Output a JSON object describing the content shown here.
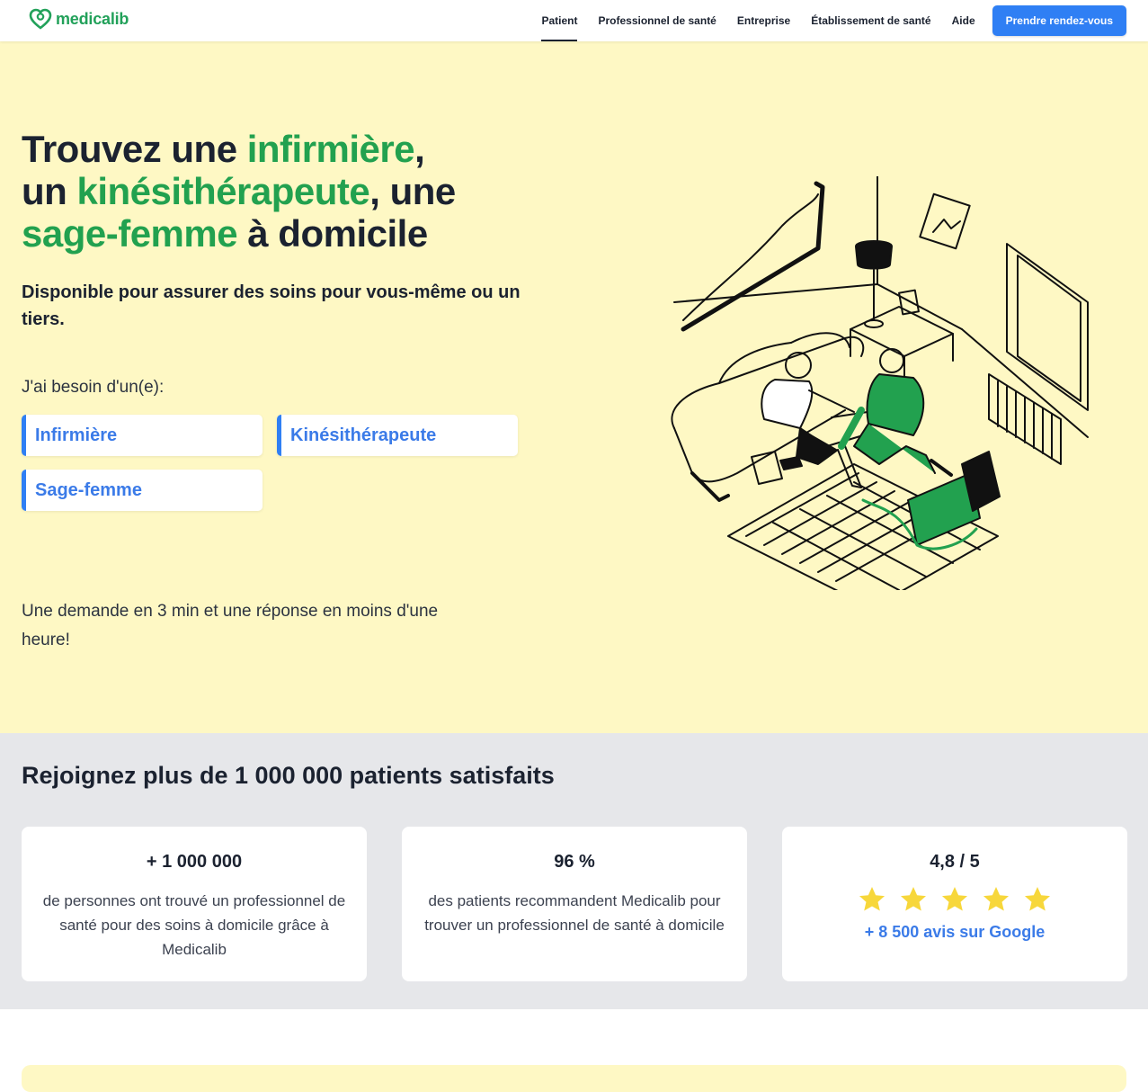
{
  "header": {
    "logo_text": "medicalib",
    "nav": [
      "Patient",
      "Professionnel de santé",
      "Entreprise",
      "Établissement de santé",
      "Aide"
    ],
    "cta_label": "Prendre rendez-vous"
  },
  "hero": {
    "title": {
      "p1": "Trouvez une ",
      "h1": "infirmière",
      "p2": ",",
      "p3": "un ",
      "h2": "kinésithérapeute",
      "p4": ", une",
      "h3": "sage-femme",
      "p5": " à domicile"
    },
    "subtitle": "Disponible pour assurer des soins pour vous-même ou un tiers.",
    "need_label": "J'ai besoin d'un(e):",
    "choices": [
      "Infirmière",
      "Kinésithérapeute",
      "Sage-femme"
    ],
    "footer_text": "Une demande en 3 min et une réponse en moins d'une heure!"
  },
  "stats": {
    "title": "Rejoignez plus de 1 000 000 patients satisfaits",
    "cards": [
      {
        "number": "+ 1 000 000",
        "text": "de personnes ont trouvé un professionnel de santé pour des soins à domicile grâce à Medicalib"
      },
      {
        "number": "96 %",
        "text": "des patients recommandent Medicalib pour trouver un professionnel de santé à domicile"
      },
      {
        "number": "4,8 / 5",
        "reviews": "+ 8 500 avis sur Google",
        "stars": 5
      }
    ]
  },
  "colors": {
    "brand_green": "#22a14f",
    "accent_blue": "#2f7ff4",
    "hero_bg": "#fef8c4",
    "stats_bg": "#e6e7ea",
    "star_yellow": "#f7d73b"
  }
}
